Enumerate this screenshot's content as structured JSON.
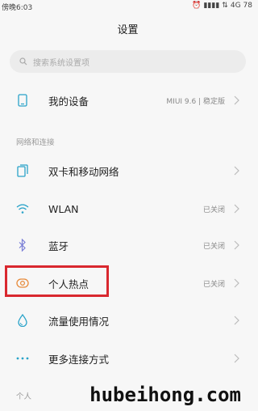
{
  "status_bar": {
    "time": "傍晚6:03",
    "alarm_icon": "alarm-clock-icon",
    "network": "4G",
    "battery": "78"
  },
  "title": "设置",
  "search": {
    "placeholder": "搜索系统设置项"
  },
  "rows": {
    "my_device": {
      "label": "我的设备",
      "value": "MIUI 9.6 | 稳定版"
    },
    "section_network": "网络和连接",
    "sim": {
      "label": "双卡和移动网络"
    },
    "wlan": {
      "label": "WLAN",
      "value": "已关闭"
    },
    "bluetooth": {
      "label": "蓝牙",
      "value": "已关闭"
    },
    "hotspot": {
      "label": "个人热点",
      "value": "已关闭"
    },
    "data_usage": {
      "label": "流量使用情况"
    },
    "more_connections": {
      "label": "更多连接方式"
    },
    "section_personal": "个人"
  },
  "watermark": "hubeihong.com",
  "colors": {
    "accent_blue": "#2aa3c9",
    "highlight_red": "#d9282f",
    "hotspot_orange": "#e78a3a",
    "bluetooth_purple": "#7a7fd6"
  }
}
